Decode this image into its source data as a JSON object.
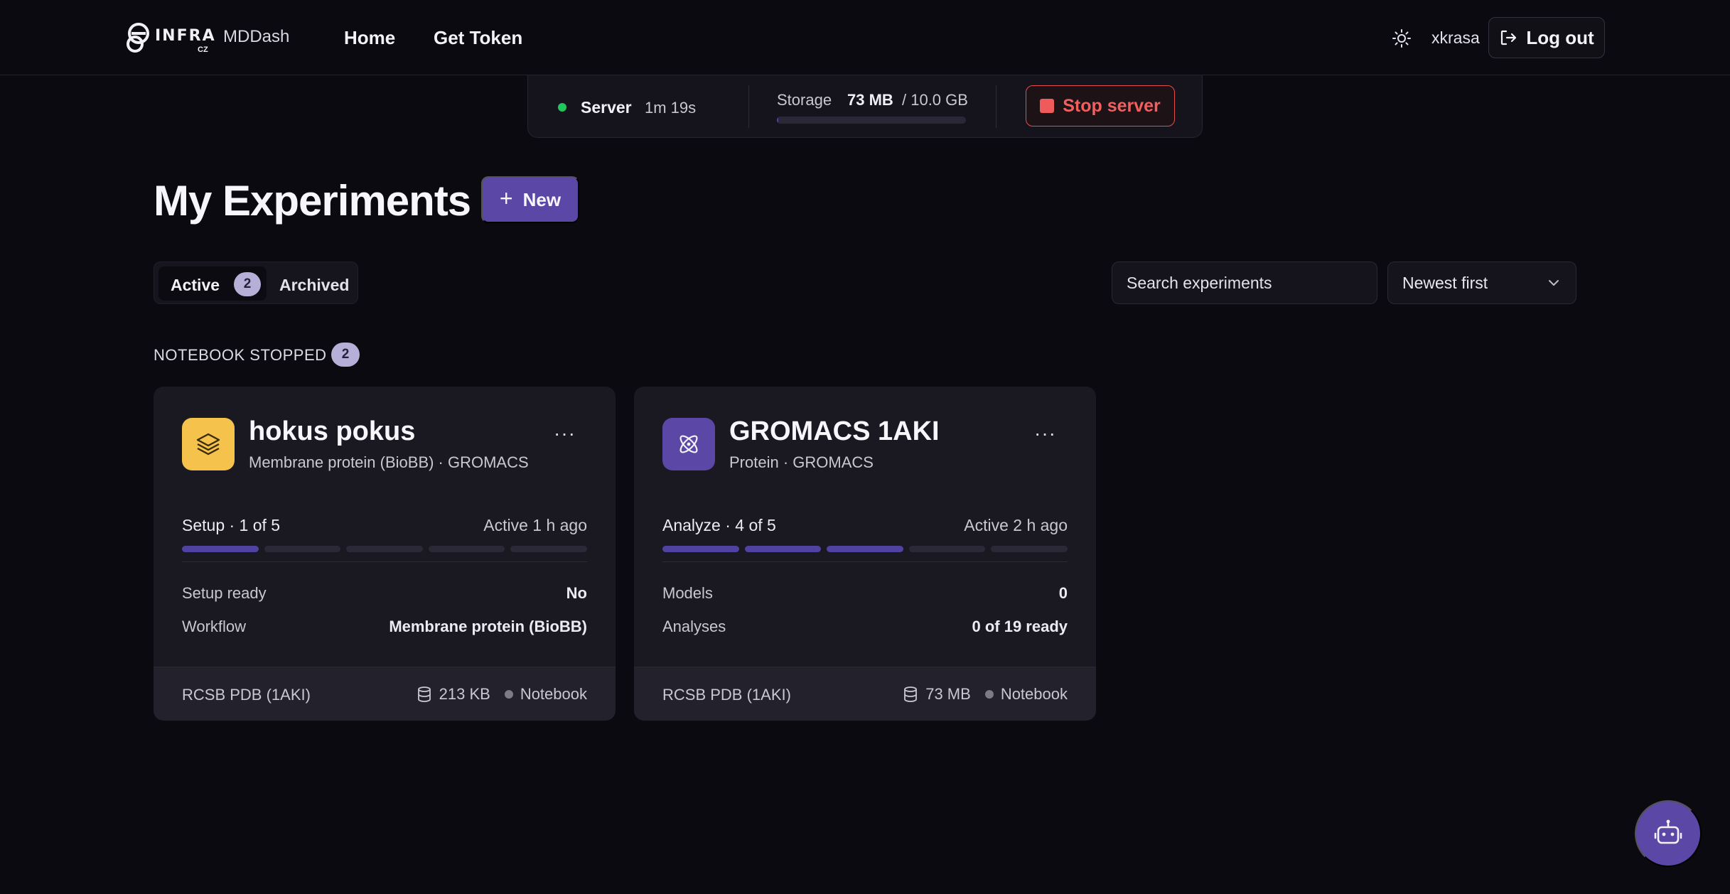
{
  "header": {
    "logo_text": "INFRA",
    "logo_sub": "CZ",
    "app_name": "MDDash",
    "nav": {
      "home": "Home",
      "get_token": "Get Token"
    },
    "username": "xkrasa",
    "logout_label": "Log out"
  },
  "server": {
    "label": "Server",
    "uptime": "1m 19s",
    "status_color": "#22c55e",
    "storage_label": "Storage",
    "storage_used": "73 MB",
    "storage_total": "/ 10.0 GB",
    "storage_fraction": 0.007,
    "stop_label": "Stop server"
  },
  "page": {
    "title": "My Experiments",
    "new_label": "New"
  },
  "filters": {
    "tab_active": "Active",
    "tab_active_count": "2",
    "tab_archived": "Archived",
    "search_placeholder": "Search experiments",
    "sort_value": "Newest first"
  },
  "group": {
    "label": "NOTEBOOK STOPPED",
    "count": "2"
  },
  "experiments": [
    {
      "icon": "layers-icon",
      "icon_color": "#f5c24b",
      "title": "hokus pokus",
      "subtitle": "Membrane protein (BioBB) · GROMACS",
      "menu": "···",
      "stage": "Setup · 1 of 5",
      "stage_done": 1,
      "stage_total": 5,
      "last_active": "Active 1 h ago",
      "rows": [
        {
          "label": "Setup ready",
          "value": "No"
        },
        {
          "label": "Workflow",
          "value": "Membrane protein (BioBB)"
        }
      ],
      "source": "RCSB PDB (1AKI)",
      "size": "213 KB",
      "mode": "Notebook"
    },
    {
      "icon": "atom-icon",
      "icon_color": "#5b47a6",
      "title": "GROMACS 1AKI",
      "subtitle": "Protein · GROMACS",
      "menu": "···",
      "stage": "Analyze · 4 of 5",
      "stage_done": 3,
      "stage_total": 5,
      "last_active": "Active 2 h ago",
      "rows": [
        {
          "label": "Models",
          "value": "0"
        },
        {
          "label": "Analyses",
          "value": "0 of 19 ready"
        }
      ],
      "source": "RCSB PDB (1AKI)",
      "size": "73 MB",
      "mode": "Notebook"
    }
  ],
  "colors": {
    "accent": "#5b47a6",
    "danger": "#ef5a5a",
    "background": "#0b0a10"
  }
}
